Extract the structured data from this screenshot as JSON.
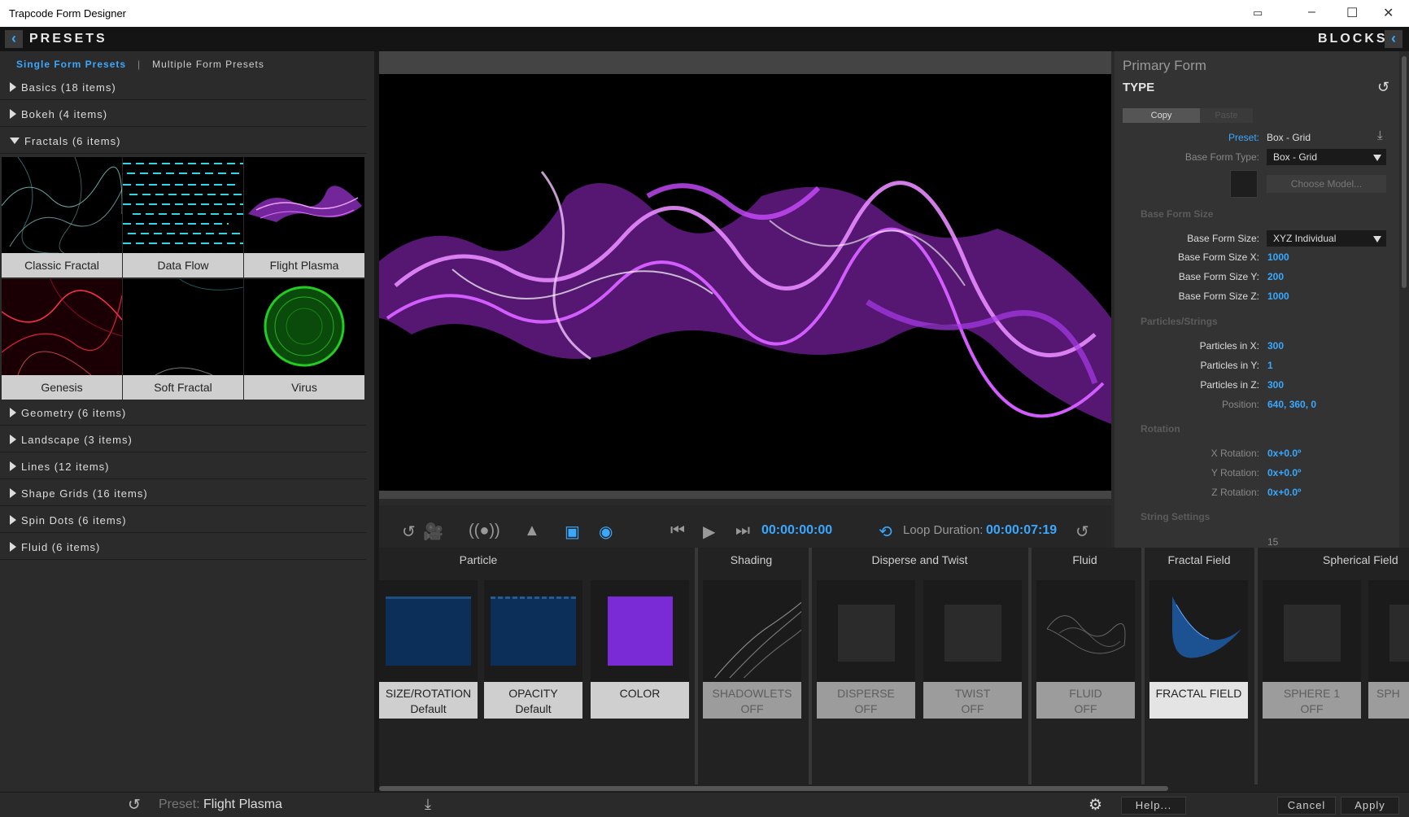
{
  "window": {
    "title": "Trapcode Form Designer"
  },
  "header": {
    "left_title": "PRESETS",
    "right_title": "BLOCKS"
  },
  "presets": {
    "tabs": [
      "Single Form Presets",
      "Multiple Form Presets"
    ],
    "categories_top": [
      {
        "label": "Basics (18 items)",
        "expanded": false
      },
      {
        "label": "Bokeh (4 items)",
        "expanded": false
      },
      {
        "label": "Fractals (6 items)",
        "expanded": true
      }
    ],
    "thumbnails": [
      "Classic Fractal",
      "Data Flow",
      "Flight Plasma",
      "Genesis",
      "Soft Fractal",
      "Virus"
    ],
    "categories_bottom": [
      {
        "label": "Geometry (6 items)"
      },
      {
        "label": "Landscape (3 items)"
      },
      {
        "label": "Lines (12 items)"
      },
      {
        "label": "Shape Grids (16 items)"
      },
      {
        "label": "Spin Dots (6 items)"
      },
      {
        "label": "Fluid (6 items)"
      }
    ]
  },
  "transport": {
    "timecode": "00:00:00:00",
    "loop_label": "Loop Duration:",
    "loop_value": "00:00:07:19"
  },
  "inspector": {
    "form_title": "Primary Form",
    "section": "TYPE",
    "copy": "Copy",
    "paste": "Paste",
    "preset_label": "Preset:",
    "preset_value": "Box - Grid",
    "base_form_type_label": "Base Form Type:",
    "base_form_type_value": "Box - Grid",
    "choose_model": "Choose Model...",
    "sect_base_form_size": "Base Form Size",
    "base_form_size_label": "Base Form Size:",
    "base_form_size_value": "XYZ Individual",
    "size_x_label": "Base Form Size X:",
    "size_x": "1000",
    "size_y_label": "Base Form Size Y:",
    "size_y": "200",
    "size_z_label": "Base Form Size Z:",
    "size_z": "1000",
    "sect_particles": "Particles/Strings",
    "px_label": "Particles in X:",
    "px": "300",
    "py_label": "Particles in Y:",
    "py": "1",
    "pz_label": "Particles in Z:",
    "pz": "300",
    "pos_label": "Position:",
    "pos": "640, 360, 0",
    "sect_rotation": "Rotation",
    "rx_label": "X Rotation:",
    "rx": "0x+0.0º",
    "ry_label": "Y Rotation:",
    "ry": "0x+0.0º",
    "rz_label": "Z Rotation:",
    "rz": "0x+0.0º",
    "sect_string": "String Settings",
    "density_value": "15"
  },
  "blocks": {
    "groups": [
      "Particle",
      "Shading",
      "Disperse and Twist",
      "Fluid",
      "Fractal Field",
      "Spherical Field"
    ],
    "cards": [
      {
        "title": "SIZE/ROTATION",
        "sub": "Default"
      },
      {
        "title": "OPACITY",
        "sub": "Default"
      },
      {
        "title": "COLOR",
        "sub": ""
      },
      {
        "title": "SHADOWLETS",
        "sub": "OFF"
      },
      {
        "title": "DISPERSE",
        "sub": "OFF"
      },
      {
        "title": "TWIST",
        "sub": "OFF"
      },
      {
        "title": "FLUID",
        "sub": "OFF"
      },
      {
        "title": "FRACTAL FIELD",
        "sub": ""
      },
      {
        "title": "SPHERE 1",
        "sub": "OFF"
      },
      {
        "title": "SPH",
        "sub": ""
      }
    ]
  },
  "bottom": {
    "preset_label": "Preset:",
    "preset_value": "Flight Plasma",
    "help": "Help...",
    "cancel": "Cancel",
    "apply": "Apply"
  },
  "colors": {
    "accent": "#3aa8ff",
    "plasma": "#d14cff",
    "virus": "#22cc22",
    "color_swatch": "#7a2bd6",
    "genesis": "#cc1a33"
  },
  "icons": [
    "back-arrow-icon",
    "reset-icon",
    "camera-icon",
    "audio-icon",
    "shadow-icon",
    "frame-icon",
    "eye-icon",
    "skip-start-icon",
    "play-icon",
    "skip-end-icon",
    "loop-icon",
    "save-icon",
    "gear-icon"
  ]
}
